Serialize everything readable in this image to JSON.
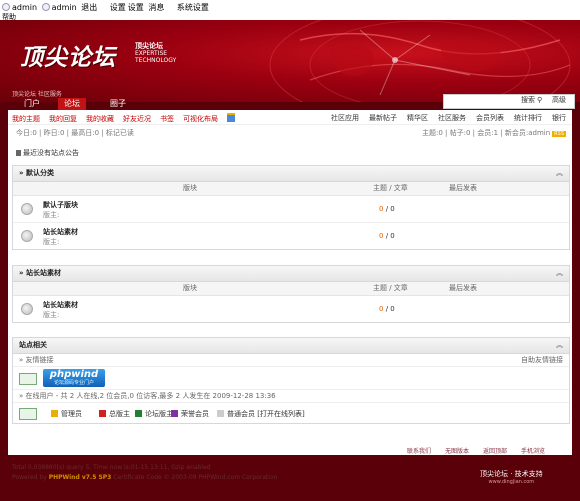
{
  "topbar": {
    "user1": "admin",
    "user2": "admin",
    "logout": "退出",
    "settings": "设置",
    "settings2": "设置",
    "messages": "消息",
    "system": "系统设置",
    "help": "帮助"
  },
  "banner": {
    "logo": "顶尖论坛",
    "sub_title": "顶尖论坛",
    "sub_en1": "EXPERTISE",
    "sub_en2": "TECHNOLOGY",
    "note": "顶尖论坛 社区服务"
  },
  "nav": {
    "tabs": [
      "门户",
      "论坛",
      "圈子"
    ],
    "active_index": 1,
    "search_btn": "搜索",
    "advanced": "高级"
  },
  "menu": {
    "left": [
      "我的主题",
      "我的回复",
      "我的收藏",
      "好友近况",
      "书签",
      "可视化布局"
    ],
    "right": [
      "社区应用",
      "最新帖子",
      "精华区",
      "社区服务",
      "会员列表",
      "统计排行",
      "银行"
    ]
  },
  "stats": {
    "left": "今日:0 | 昨日:0 | 最高日:0 | 标记已读",
    "right": "主题:0 | 帖子:0 | 会员:1 | 新会员:admin",
    "rss": "RSS"
  },
  "notice": "最近没有站点公告",
  "columns": {
    "forum": "版块",
    "topics": "主题 / 文章",
    "last_post": "最后发表"
  },
  "sections": [
    {
      "title": "默认分类",
      "forums": [
        {
          "name": "默认子版块",
          "mod": "版主:",
          "topics": "0",
          "posts": "0"
        },
        {
          "name": "站长站素材",
          "mod": "版主:",
          "topics": "0",
          "posts": "0"
        }
      ]
    },
    {
      "title": "站长站素材",
      "forums": [
        {
          "name": "站长站素材",
          "mod": "版主:",
          "topics": "0",
          "posts": "0"
        }
      ]
    }
  ],
  "site": {
    "title": "站点相关",
    "friend_links": "» 友情链接",
    "apply_link": "自助友情链接",
    "pw_logo": "phpwind",
    "pw_logo_sub": "论坛源码专业门户",
    "online": "» 在线用户 - 共 2 人在线,2 位会员,0 位访客,最多 2 人发生在 2009-12-28 13:36",
    "legend": [
      "管理员",
      "总版主",
      "论坛版主",
      "荣誉会员",
      "普通会员 [打开在线列表]"
    ],
    "legend_colors": [
      "#e8b000",
      "#d02020",
      "#208030",
      "#8030a0",
      "#cccccc"
    ]
  },
  "footer": {
    "links": [
      "联系我们",
      "无图版本",
      "返回顶部",
      "手机浏览"
    ],
    "line1": "Total 0.038860(s) query 5, Time now is:01-15 13:11, Gzip enabled",
    "line2_pre": "Powered by ",
    "line2_pw": "PHPWind",
    "line2_ver": " v7.5 SP3",
    "line2_cert": " Certificate",
    "line2_post": " Code © 2003-09 PHPWind.com Corporation",
    "brand": "顶尖论坛 · 技术支持",
    "brand_sub": "www.dingjian.com"
  }
}
